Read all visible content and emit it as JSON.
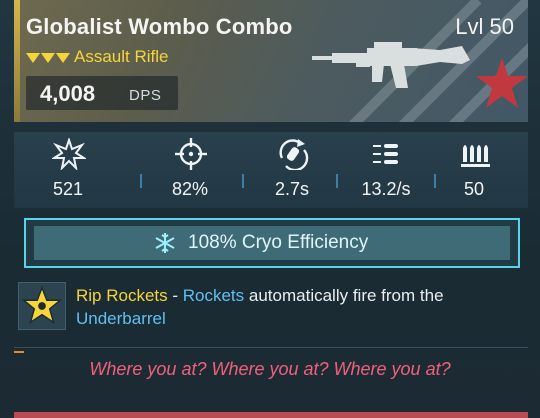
{
  "item": {
    "name": "Globalist Wombo Combo",
    "level": "Lvl 50",
    "type": "Assault Rifle",
    "dps_value": "4,008",
    "dps_unit": "DPS",
    "rarity_color": "#f5d53a"
  },
  "stats": [
    {
      "icon": "burst-icon",
      "value": "521"
    },
    {
      "icon": "crosshair-icon",
      "value": "82%"
    },
    {
      "icon": "reload-icon",
      "value": "2.7s"
    },
    {
      "icon": "fire-rate-icon",
      "value": "13.2/s"
    },
    {
      "icon": "magazine-icon",
      "value": "50"
    }
  ],
  "element": {
    "icon": "snowflake-icon",
    "text": "108% Cryo Efficiency",
    "color": "#5ad4e6"
  },
  "perk": {
    "icon": "star-badge-icon",
    "name": "Rip Rockets",
    "dash": " - ",
    "kw1": "Rockets",
    "text1": " automatically fire from the ",
    "kw2": "Underbarrel"
  },
  "flavor": "Where you at? Where you at? Where you at?"
}
